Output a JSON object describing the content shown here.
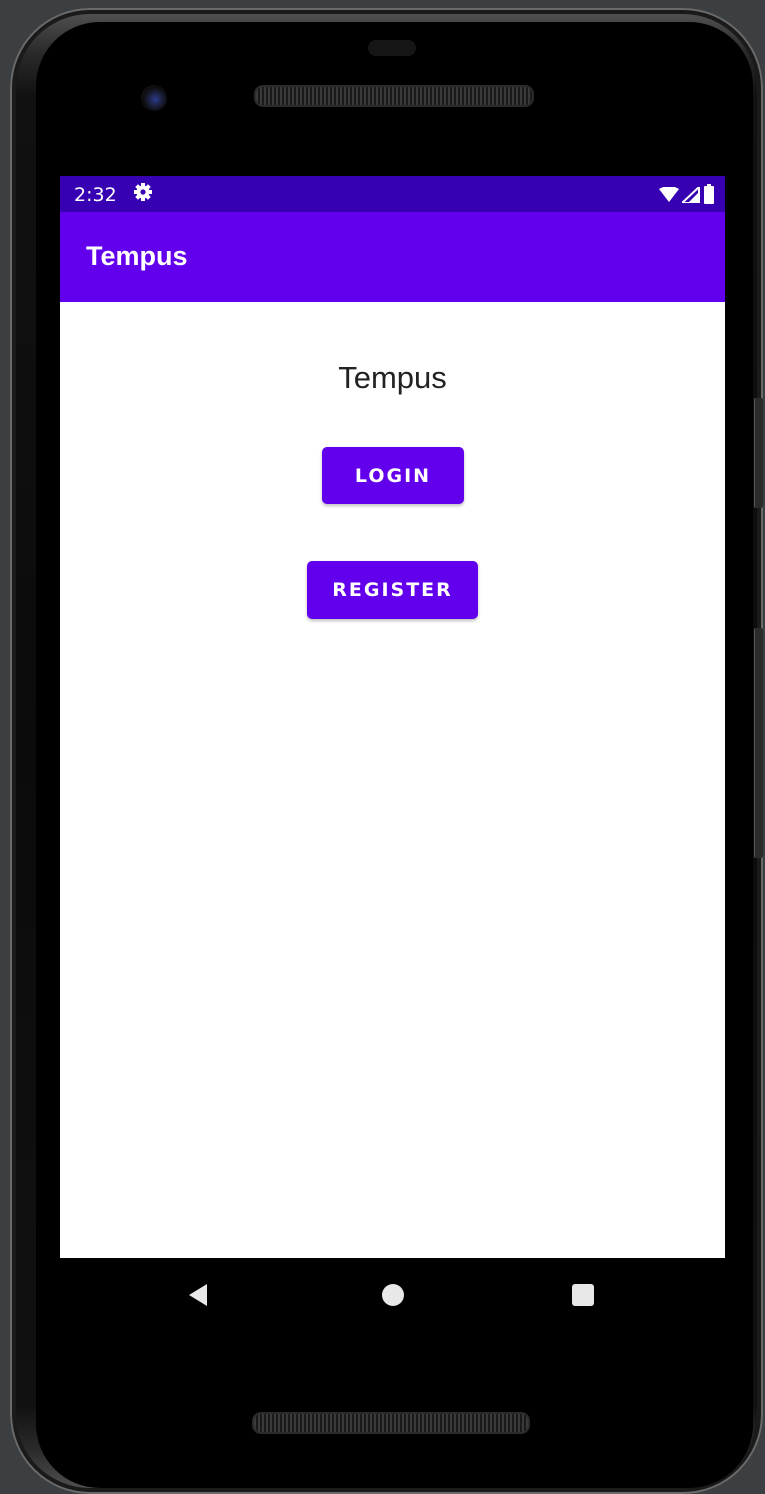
{
  "status_bar": {
    "time": "2:32",
    "settings_icon": "gear-icon",
    "wifi_icon": "wifi-icon",
    "signal_icon": "cell-signal-icon",
    "battery_icon": "battery-icon",
    "background_color": "#3700b3"
  },
  "app_bar": {
    "title": "Tempus",
    "background_color": "#6200ee"
  },
  "main": {
    "title": "Tempus",
    "login_label": "LOGIN",
    "register_label": "REGISTER",
    "button_color": "#6200ee"
  },
  "nav_bar": {
    "back_icon": "back-triangle-icon",
    "home_icon": "home-circle-icon",
    "recents_icon": "recents-square-icon"
  }
}
